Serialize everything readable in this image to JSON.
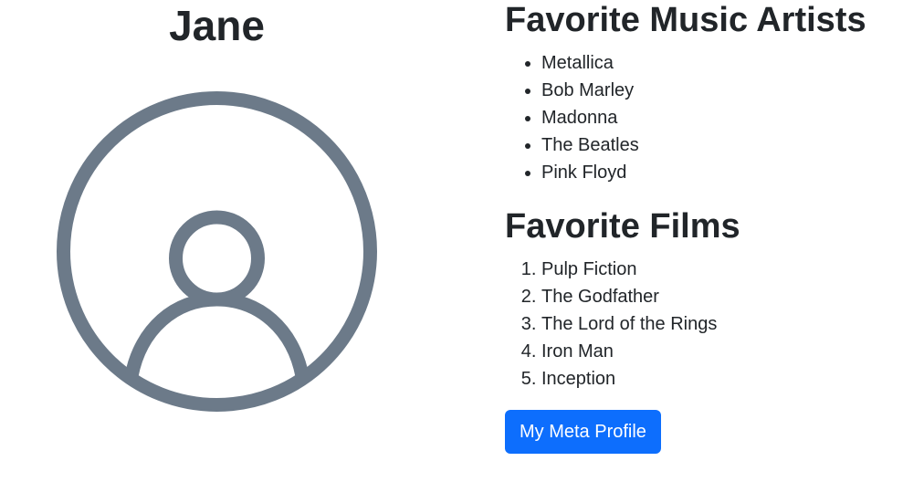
{
  "profile": {
    "name": "Jane",
    "avatar_icon": "user-circle-icon",
    "avatar_color": "#6c7a89"
  },
  "artists": {
    "heading": "Favorite Music Artists",
    "items": [
      "Metallica",
      "Bob Marley",
      "Madonna",
      "The Beatles",
      "Pink Floyd"
    ]
  },
  "films": {
    "heading": "Favorite Films",
    "items": [
      "Pulp Fiction",
      "The Godfather",
      "The Lord of the Rings",
      "Iron Man",
      "Inception"
    ]
  },
  "actions": {
    "meta_profile_label": "My Meta Profile",
    "button_color": "#0d6efd"
  }
}
